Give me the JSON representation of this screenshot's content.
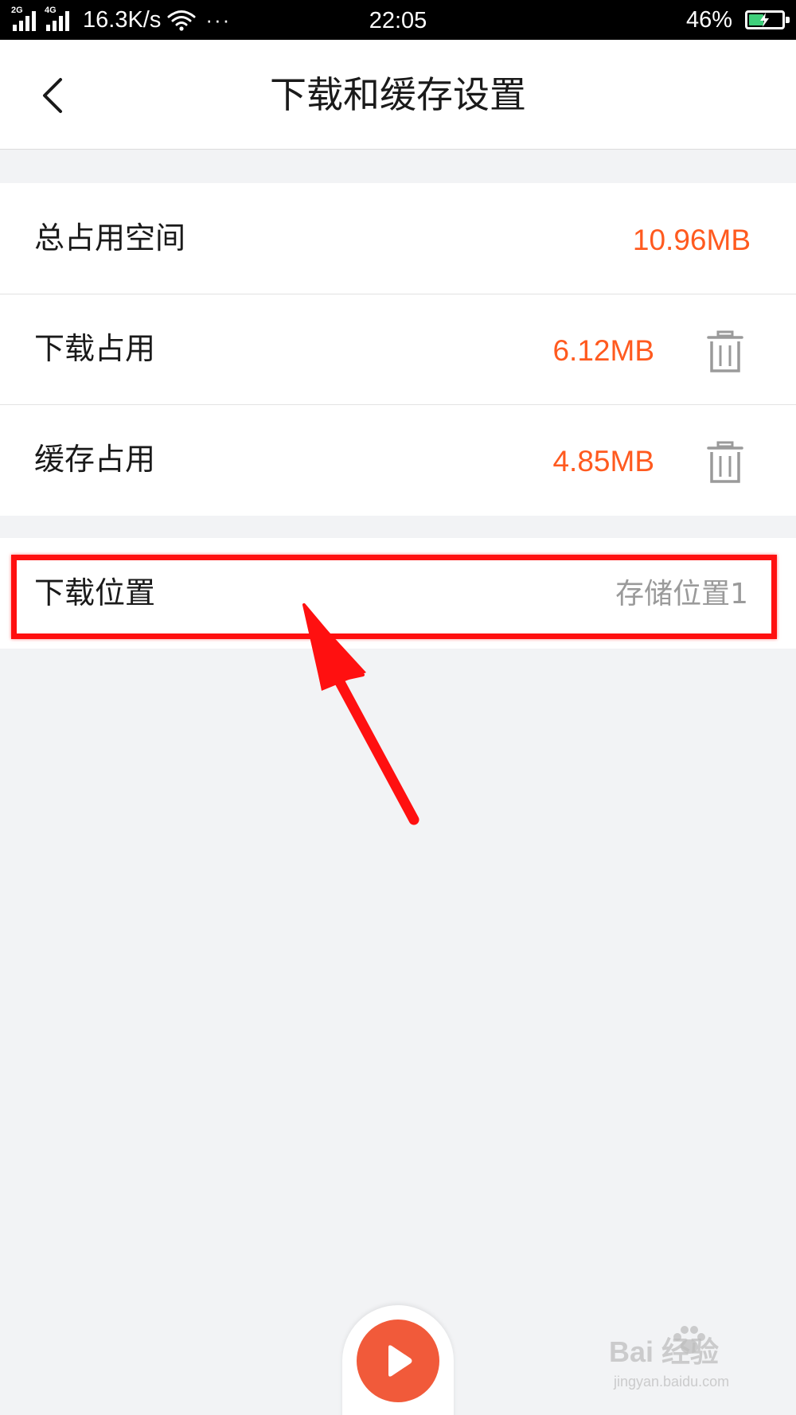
{
  "status_bar": {
    "network_1": "2G",
    "network_2": "4G",
    "speed": "16.3K/s",
    "more": "···",
    "time": "22:05",
    "battery_percent": "46%",
    "battery_level": 0.46,
    "icons": [
      "signal-icon",
      "wifi-icon",
      "battery-icon",
      "charging-icon"
    ]
  },
  "header": {
    "back_icon": "chevron-left-icon",
    "title": "下载和缓存设置"
  },
  "storage": {
    "rows": [
      {
        "label": "总占用空间",
        "value": "10.96MB"
      },
      {
        "label": "下载占用",
        "value": "6.12MB",
        "action_icon": "trash-icon"
      },
      {
        "label": "缓存占用",
        "value": "4.85MB",
        "action_icon": "trash-icon"
      }
    ]
  },
  "download_location": {
    "label": "下载位置",
    "value": "存储位置1"
  },
  "player": {
    "icon": "play-icon"
  },
  "watermark": {
    "main": "Bai  经验",
    "sub": "jingyan.baidu.com"
  },
  "colors": {
    "value_accent": "#ff5a1f",
    "annotation_red": "#ff1010",
    "play_button": "#f15a3a",
    "background": "#f2f3f5"
  }
}
